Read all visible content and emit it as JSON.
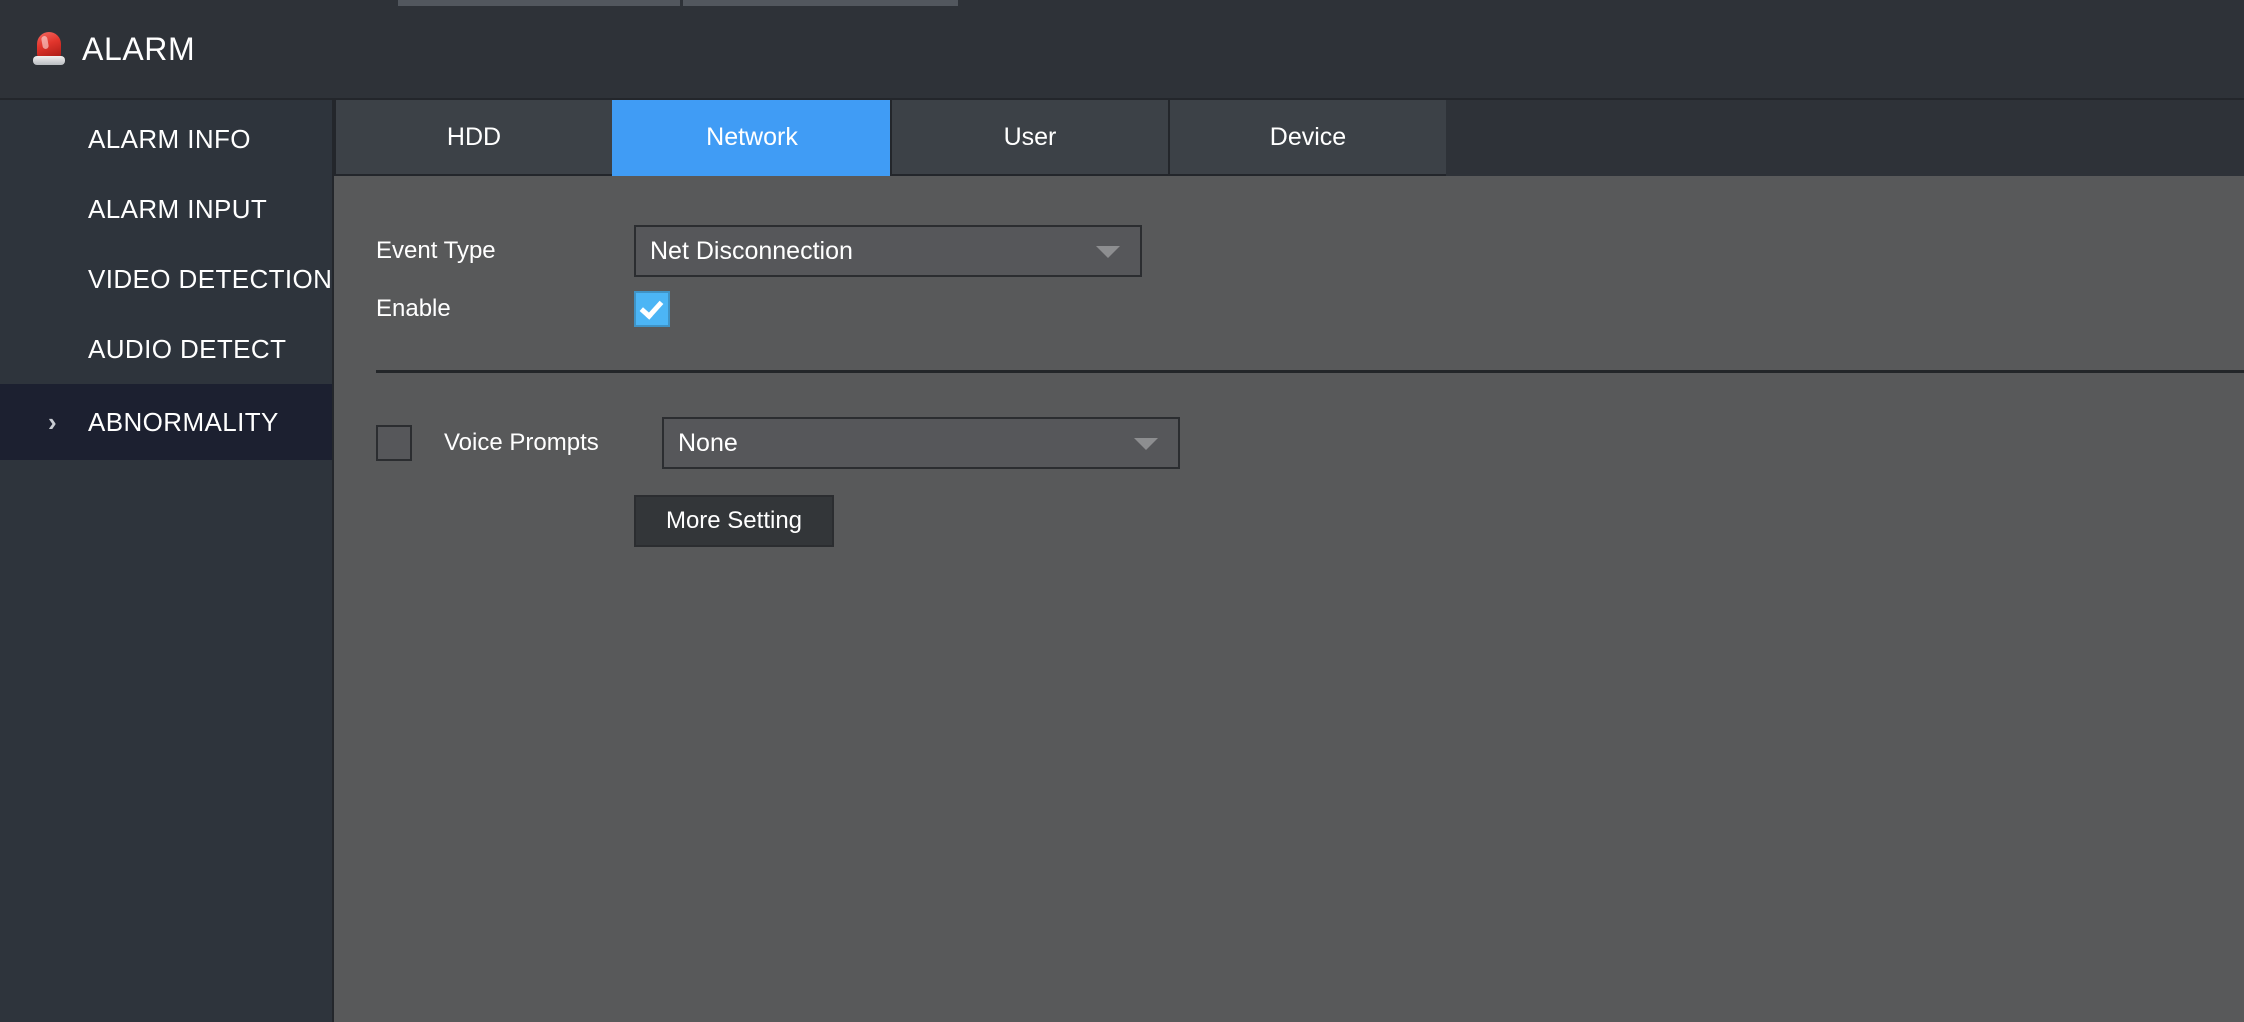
{
  "header": {
    "title": "ALARM",
    "icon": "alarm-siren-icon"
  },
  "sidebar": {
    "items": [
      {
        "label": "ALARM INFO",
        "active": false,
        "chevron": ""
      },
      {
        "label": "ALARM INPUT",
        "active": false,
        "chevron": ""
      },
      {
        "label": "VIDEO DETECTION",
        "active": false,
        "chevron": ""
      },
      {
        "label": "AUDIO DETECT",
        "active": false,
        "chevron": ""
      },
      {
        "label": "ABNORMALITY",
        "active": true,
        "chevron": "›"
      }
    ]
  },
  "tabs": [
    {
      "label": "HDD",
      "active": false
    },
    {
      "label": "Network",
      "active": true
    },
    {
      "label": "User",
      "active": false
    },
    {
      "label": "Device",
      "active": false
    }
  ],
  "form": {
    "event_type_label": "Event Type",
    "event_type_value": "Net Disconnection",
    "enable_label": "Enable",
    "enable_checked": true,
    "voice_prompts_label": "Voice Prompts",
    "voice_prompts_checked": false,
    "voice_prompts_value": "None",
    "more_setting_label": "More Setting"
  },
  "colors": {
    "accent_blue": "#409cf5",
    "checkbox_blue": "#4cb5f5",
    "panel_gray": "#58595a",
    "sidebar_dark": "#2e343c",
    "sidebar_active": "#1c2030",
    "header_dark": "#2e3238"
  }
}
